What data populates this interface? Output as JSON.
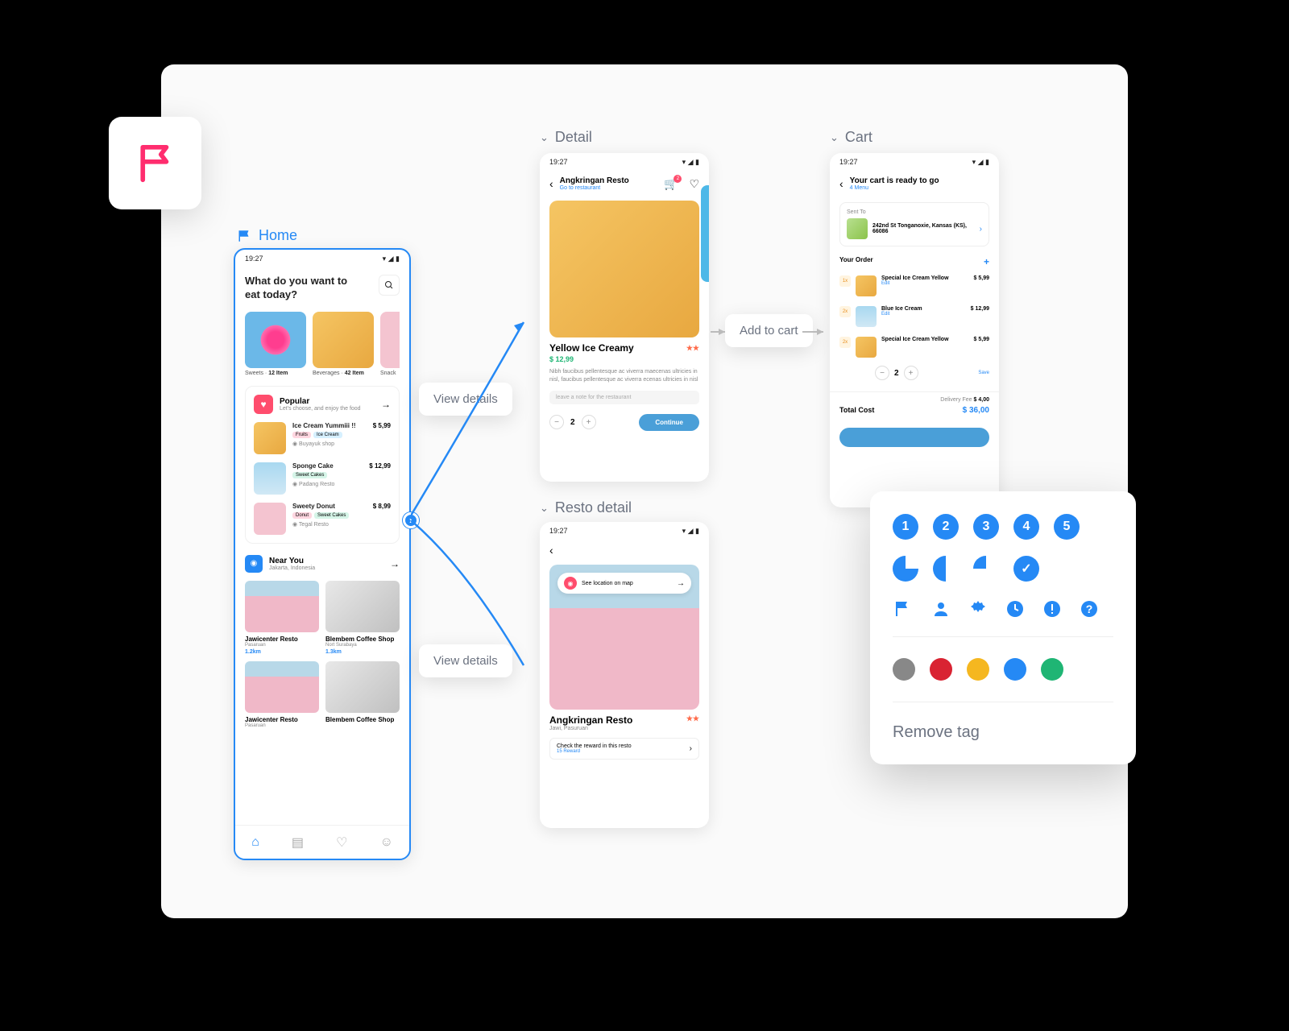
{
  "sections": {
    "home": "Home",
    "detail": "Detail",
    "resto": "Resto detail",
    "cart": "Cart"
  },
  "home": {
    "time": "19:27",
    "title_line1": "What do you want to",
    "title_line2": "eat today?",
    "categories": [
      {
        "name": "Sweets",
        "count": "12 Item"
      },
      {
        "name": "Beverages",
        "count": "42 Item"
      },
      {
        "name": "Snack",
        "count": ""
      }
    ],
    "popular": {
      "title": "Popular",
      "subtitle": "Let's choose, and enjoy the food",
      "items": [
        {
          "name": "Ice Cream Yummiii !!",
          "tags": [
            "Fruits",
            "Ice Cream"
          ],
          "tag_colors": [
            "#ffd6e0",
            "#d6f0ff"
          ],
          "shop": "Buyayuk shop",
          "price": "$ 5,99",
          "thumb": "ice-bg"
        },
        {
          "name": "Sponge Cake",
          "tags": [
            "Sweet Cakes"
          ],
          "tag_colors": [
            "#d6f5e8"
          ],
          "shop": "Padang Resto",
          "price": "$ 12,99",
          "thumb": "blue-sky"
        },
        {
          "name": "Sweety Donut",
          "tags": [
            "Donut",
            "Sweet Cakes"
          ],
          "tag_colors": [
            "#ffd6e0",
            "#d6f5e8"
          ],
          "shop": "Tegal Resto",
          "price": "$ 8,99",
          "thumb": "pink-bg"
        }
      ]
    },
    "near": {
      "title": "Near You",
      "location": "Jakarta, Indonesia",
      "items": [
        {
          "name": "Jawicenter Resto",
          "loc": "Pasaruan",
          "dist": "1.2km",
          "thumb": "building-pink"
        },
        {
          "name": "Blembem Coffee Shop",
          "loc": "Nort Surabaya",
          "dist": "1.3km",
          "thumb": "building-mono"
        },
        {
          "name": "Jawicenter Resto",
          "loc": "Pasaruan",
          "dist": "",
          "thumb": "building-pink"
        },
        {
          "name": "Blembem Coffee Shop",
          "loc": "",
          "dist": "",
          "thumb": "building-mono"
        }
      ]
    }
  },
  "detail": {
    "time": "19:27",
    "resto": "Angkringan Resto",
    "go_link": "Go to restaurant",
    "cart_count": "2",
    "name": "Yellow Ice Creamy",
    "stars": "★★",
    "price": "$ 12,99",
    "desc": "Nibh faucibus pellentesque ac viverra maecenas ultricies in nisl, faucibus pellentesque ac viverra ecenas ultricies in nisl",
    "note_placeholder": "leave a note for the restaurant",
    "qty": "2",
    "continue": "Continue"
  },
  "resto": {
    "time": "19:27",
    "loc_pill": "See location on map",
    "name": "Angkringan Resto",
    "stars": "★★",
    "location": "Jawi, Pasuruan",
    "reward_text": "Check the reward in this resto",
    "reward_count": "15 Reward"
  },
  "cart": {
    "time": "19:27",
    "title": "Your cart is ready to go",
    "subtitle": "4 Menu",
    "sent_label": "Sent To",
    "address": "242nd St Tonganoxie, Kansas (KS), 66086",
    "order_title": "Your Order",
    "items": [
      {
        "qty": "1x",
        "name": "Special Ice Cream Yellow",
        "edit": "Edit",
        "price": "$ 5,99",
        "thumb": "ice-bg"
      },
      {
        "qty": "2x",
        "name": "Blue Ice Cream",
        "edit": "Edit",
        "price": "$ 12,99",
        "thumb": "blue-sky"
      },
      {
        "qty": "2x",
        "name": "Special Ice Cream Yellow",
        "edit": "",
        "price": "$ 5,99",
        "thumb": "ice-bg",
        "controls": true,
        "qty_val": "2",
        "save": "Save"
      }
    ],
    "delivery_label": "Delivery Fee",
    "delivery_fee": "$ 4,00",
    "total_label": "Total Cost",
    "total": "$ 36,00"
  },
  "callouts": {
    "view_details1": "View details",
    "view_details2": "View details",
    "add_to_cart": "Add to cart"
  },
  "tag_panel": {
    "numbers": [
      "1",
      "2",
      "3",
      "4",
      "5"
    ],
    "colors": [
      "#888888",
      "#d92332",
      "#f5b720",
      "#2589f5",
      "#1fb574"
    ],
    "remove": "Remove tag"
  }
}
